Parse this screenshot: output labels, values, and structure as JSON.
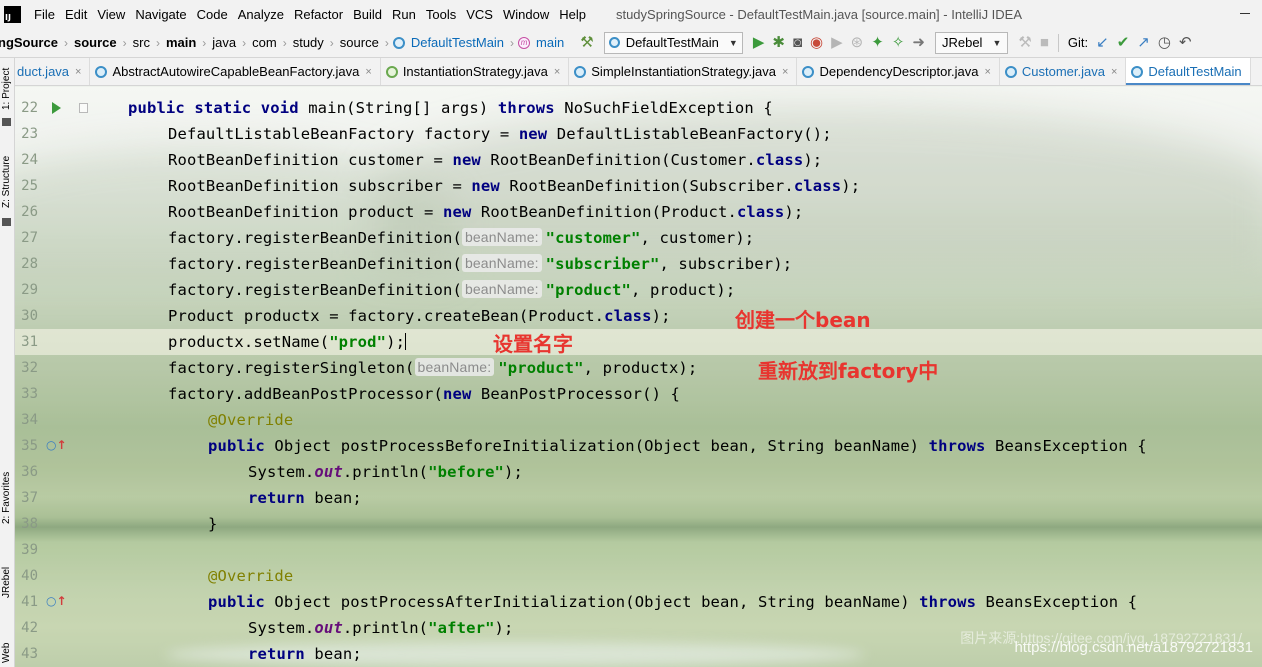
{
  "menubar": {
    "logo": "IJ",
    "items": [
      "File",
      "Edit",
      "View",
      "Navigate",
      "Code",
      "Analyze",
      "Refactor",
      "Build",
      "Run",
      "Tools",
      "VCS",
      "Window",
      "Help"
    ],
    "window_title": "studySpringSource - DefaultTestMain.java [source.main] - IntelliJ IDEA"
  },
  "breadcrumb": {
    "items": [
      "ngSource",
      "source",
      "src",
      "main",
      "java",
      "com",
      "study",
      "source",
      "DefaultTestMain",
      "main"
    ],
    "method_icon_letter": "m"
  },
  "toolbar": {
    "run_config": "DefaultTestMain",
    "jrebel": "JRebel",
    "git_label": "Git:",
    "colors": {
      "run_green": "#3c9a3c",
      "git_blue": "#3a7ec2"
    }
  },
  "side_tabs": [
    "1: Project",
    "Z: Structure",
    "2: Favorites",
    "JRebel",
    "Web"
  ],
  "tabs": [
    {
      "label": "duct.java"
    },
    {
      "label": "AbstractAutowireCapableBeanFactory.java"
    },
    {
      "label": "InstantiationStrategy.java"
    },
    {
      "label": "SimpleInstantiationStrategy.java"
    },
    {
      "label": "DependencyDescriptor.java"
    },
    {
      "label": "Customer.java"
    },
    {
      "label": "DefaultTestMain"
    }
  ],
  "tab_close_glyph": "×",
  "editor": {
    "line_numbers": [
      "22",
      "23",
      "24",
      "25",
      "26",
      "27",
      "28",
      "29",
      "30",
      "31",
      "32",
      "33",
      "34",
      "35",
      "36",
      "37",
      "38",
      "39",
      "40",
      "41",
      "42",
      "43"
    ],
    "hint_label": "beanName:",
    "tokens": {
      "public": "public",
      "static": "static",
      "void": "void",
      "throws": "throws",
      "new": "new",
      "class": "class",
      "return": "return",
      "main_sig": " main(String[] args) ",
      "no_such_field": " NoSuchFieldException {",
      "dlbf_decl": "DefaultListableBeanFactory factory = ",
      "dlbf_ctor": " DefaultListableBeanFactory();",
      "rbd_customer": "RootBeanDefinition customer = ",
      "rbd_subscriber": "RootBeanDefinition subscriber = ",
      "rbd_product": "RootBeanDefinition product = ",
      "rbd_ctor_customer": " RootBeanDefinition(Customer.",
      "rbd_ctor_subscriber": " RootBeanDefinition(Subscriber.",
      "rbd_ctor_product": " RootBeanDefinition(Product.",
      "close_paren_semi": ");",
      "register_def": "factory.registerBeanDefinition(",
      "str_customer": "\"customer\"",
      "str_subscriber": "\"subscriber\"",
      "str_product": "\"product\"",
      "arg_customer": ", customer);",
      "arg_subscriber": ", subscriber);",
      "arg_product": ", product);",
      "create_bean": "Product productx = factory.createBean(Product.",
      "set_name": "productx.setName(",
      "str_prod": "\"prod\"",
      "register_singleton": "factory.registerSingleton(",
      "arg_productx": ", productx);",
      "add_bpp": "factory.addBeanPostProcessor(",
      "bpp_ctor": " BeanPostProcessor() {",
      "override": "@Override",
      "object_ret": " Object ",
      "before_sig": "postProcessBeforeInitialization(Object bean, String beanName) ",
      "after_sig": "postProcessAfterInitialization(Object bean, String beanName) ",
      "beans_exc": " BeansException {",
      "system": "System.",
      "out": "out",
      "println_open": ".println(",
      "str_before": "\"before\"",
      "str_after": "\"after\"",
      "bean_semi": " bean;",
      "close_brace": "}"
    }
  },
  "annotations": {
    "create": "创建一个bean",
    "setname": "设置名字",
    "reput": "重新放到factory中"
  },
  "watermark": {
    "line1": "图片来源:https://gitee.com/jyq_18792721831/",
    "line2": "https://blog.csdn.net/a18792721831"
  }
}
